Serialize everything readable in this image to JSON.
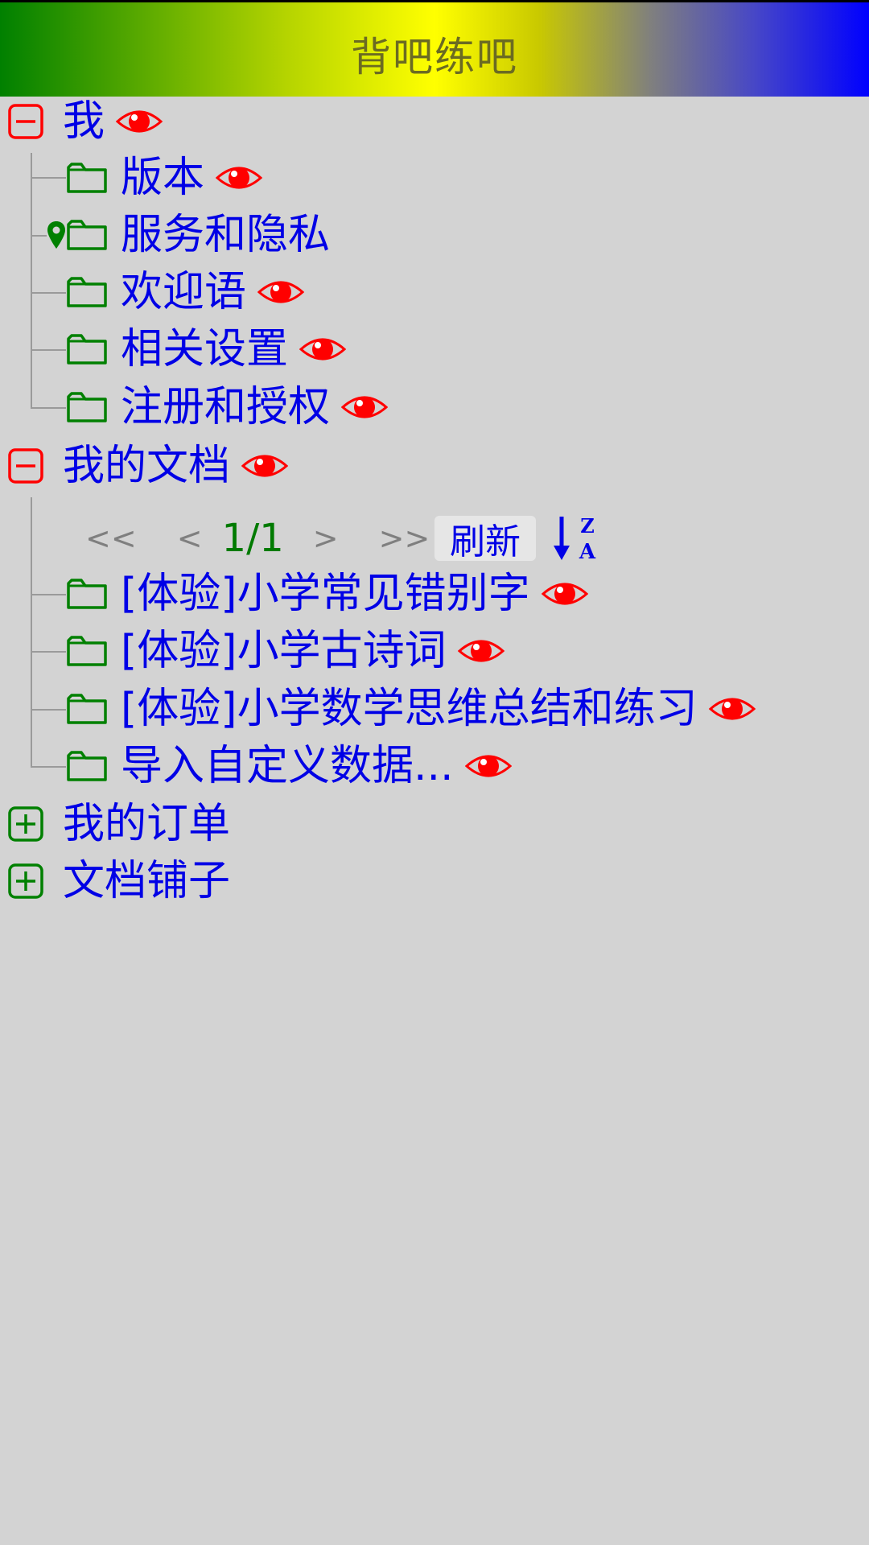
{
  "header": {
    "title": "背吧练吧"
  },
  "colors": {
    "background": "#d3d3d3",
    "text_blue": "#0000e6",
    "icon_red": "#ff0000",
    "icon_green": "#008000",
    "connector": "#9a9a9a"
  },
  "tree": {
    "me": {
      "label": "我",
      "expanded": true,
      "icon": "minus-box-icon",
      "children": [
        {
          "label": "版本"
        },
        {
          "label": "服务和隐私"
        },
        {
          "label": "欢迎语"
        },
        {
          "label": "相关设置"
        },
        {
          "label": "注册和授权"
        }
      ]
    },
    "docs": {
      "label": "我的文档",
      "expanded": true,
      "icon": "minus-box-icon",
      "pager": {
        "first": "<<",
        "prev": "<",
        "info": "1/1",
        "next": ">",
        "last": ">>",
        "refresh": "刷新",
        "sort_top": "Z",
        "sort_bottom": "A"
      },
      "children": [
        {
          "label": "[体验]小学常见错别字"
        },
        {
          "label": "[体验]小学古诗词"
        },
        {
          "label": "[体验]小学数学思维总结和练习"
        },
        {
          "label": "导入自定义数据..."
        }
      ]
    },
    "orders": {
      "label": "我的订单",
      "expanded": false,
      "icon": "plus-box-icon"
    },
    "shop": {
      "label": "文档铺子",
      "expanded": false,
      "icon": "plus-box-icon"
    }
  }
}
